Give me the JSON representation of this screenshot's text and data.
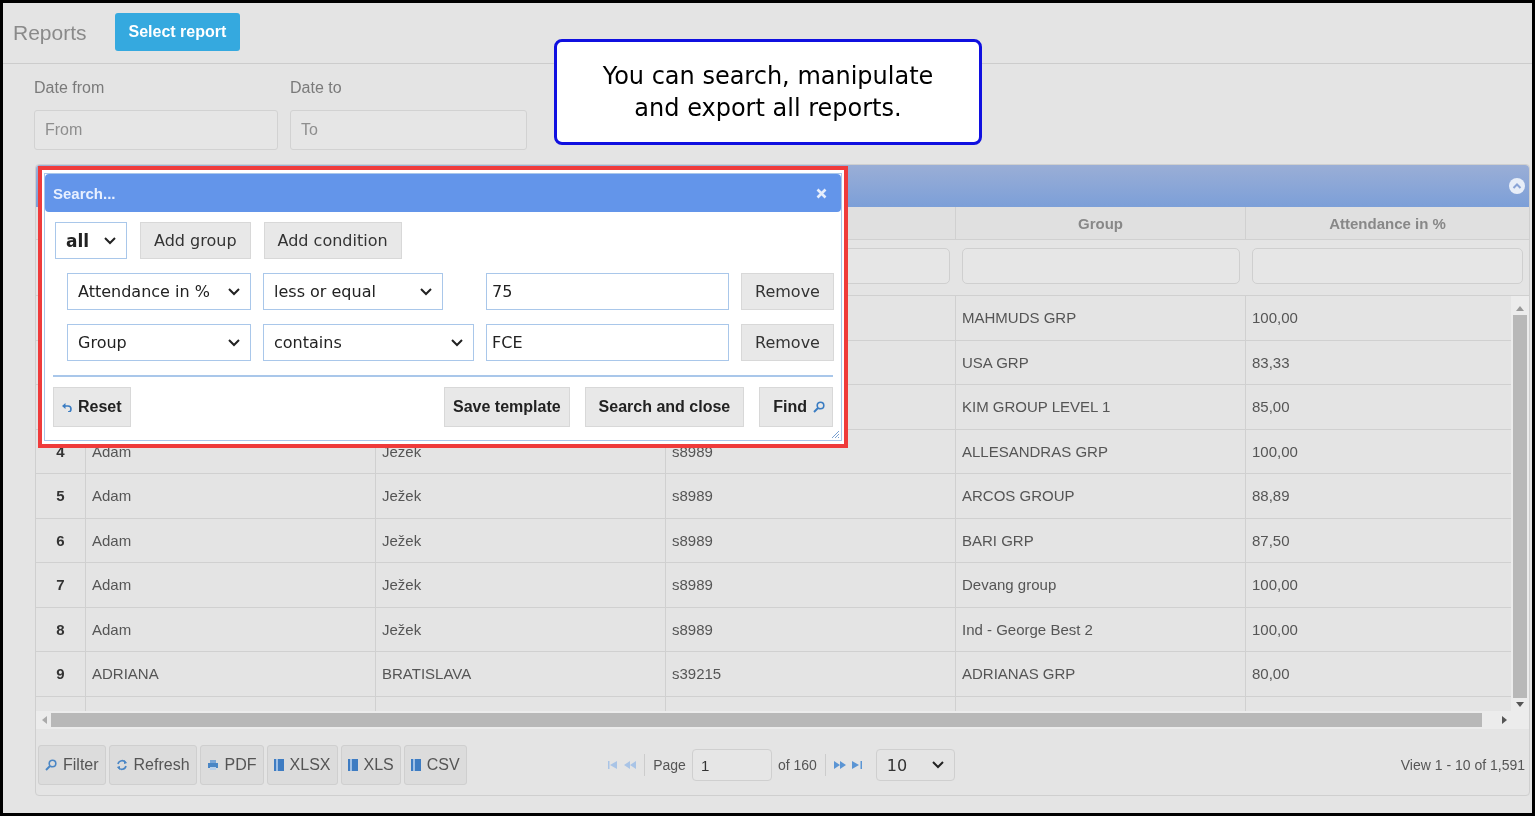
{
  "header": {
    "title": "Reports",
    "button": "Select report"
  },
  "date_filters": [
    {
      "label": "Date from",
      "placeholder": "From"
    },
    {
      "label": "Date to",
      "placeholder": "To"
    }
  ],
  "callout": {
    "text": "You can search, manipulate and export all reports."
  },
  "table": {
    "columns": [
      {
        "label": "Group"
      },
      {
        "label": "Attendance in %"
      }
    ],
    "rows": [
      {
        "group": "MAHMUDS GRP",
        "attendance": "100,00"
      },
      {
        "group": "USA GRP",
        "attendance": "83,33"
      },
      {
        "group": "KIM GROUP LEVEL 1",
        "attendance": "85,00"
      },
      {
        "number": "4",
        "first_name": "Adam",
        "last_name": "Ježek",
        "code": "s8989",
        "group": "ALLESANDRAS GRP",
        "attendance": "100,00"
      },
      {
        "number": "5",
        "first_name": "Adam",
        "last_name": "Ježek",
        "code": "s8989",
        "group": "ARCOS GROUP",
        "attendance": "88,89"
      },
      {
        "number": "6",
        "first_name": "Adam",
        "last_name": "Ježek",
        "code": "s8989",
        "group": "BARI GRP",
        "attendance": "87,50"
      },
      {
        "number": "7",
        "first_name": "Adam",
        "last_name": "Ježek",
        "code": "s8989",
        "group": "Devang group",
        "attendance": "100,00"
      },
      {
        "number": "8",
        "first_name": "Adam",
        "last_name": "Ježek",
        "code": "s8989",
        "group": "Ind - George Best 2",
        "attendance": "100,00"
      },
      {
        "number": "9",
        "first_name": "ADRIANA",
        "last_name": "BRATISLAVA",
        "code": "s39215",
        "group": "ADRIANAS GRP",
        "attendance": "80,00"
      }
    ]
  },
  "toolbar": [
    {
      "label": "Filter",
      "kind": "search"
    },
    {
      "label": "Refresh",
      "kind": "refresh"
    },
    {
      "label": "PDF",
      "kind": "print"
    },
    {
      "label": "XLSX",
      "kind": "file"
    },
    {
      "label": "XLS",
      "kind": "file"
    },
    {
      "label": "CSV",
      "kind": "file"
    }
  ],
  "pager": {
    "page_label": "Page",
    "page": "1",
    "of": "of 160",
    "rows_per_page": "10",
    "summary": "View 1 - 10 of 1,591"
  },
  "search_dialog": {
    "title": "Search...",
    "match": "all",
    "group_buttons": [
      "Add group",
      "Add condition"
    ],
    "conditions": [
      {
        "field": "Attendance in %",
        "operator": "less or equal",
        "value": "75",
        "remove": "Remove"
      },
      {
        "field": "Group",
        "operator": "contains",
        "value": "FCE",
        "remove": "Remove"
      }
    ],
    "reset": "Reset",
    "actions": [
      {
        "label": "Save template",
        "kind": "plain"
      },
      {
        "label": "Search and close",
        "kind": "plain"
      },
      {
        "label": "Find",
        "kind": "find"
      }
    ]
  }
}
